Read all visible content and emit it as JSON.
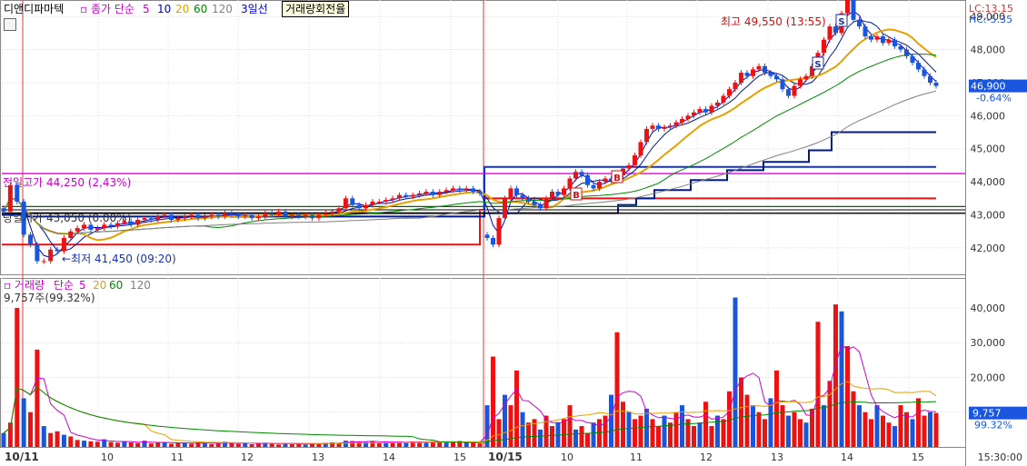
{
  "header": {
    "title": "디앤디파마텍",
    "ma_label": "종가 단순",
    "ma_periods": [
      "5",
      "10",
      "20",
      "60",
      "120"
    ],
    "ma_colors": [
      "#cc00cc",
      "#0000cc",
      "#e6a100",
      "#008800",
      "#808080"
    ],
    "line_label": "3일선",
    "tooltip": "거래량회전율"
  },
  "right_header": {
    "lc": "LC:13.15",
    "hc": "HC:-5.35"
  },
  "annotations": {
    "high_label": "최고 49,550 (13:55)",
    "low_label": "최저 41,450 (09:20)",
    "prev_high_label": "전일고가 44,250 (2,43%)",
    "prev_open_label": "당일시가 43,050 (0.00%)",
    "current_price": "46,900",
    "current_change": "-0.64%",
    "signal_s": "S",
    "signal_b": "B"
  },
  "volume_header": {
    "title": "거래량",
    "ma_label": "단순",
    "ma_periods": [
      "5",
      "20",
      "60",
      "120"
    ],
    "current": "9,757주(99.32%)",
    "current_value": "9,757",
    "current_pct": "99.32%"
  },
  "x_axis": {
    "labels": [
      "10/11",
      "10",
      "11",
      "12",
      "13",
      "14",
      "15",
      "10/15",
      "10",
      "11",
      "12",
      "13",
      "14",
      "15"
    ],
    "time": "15:30:00"
  },
  "chart_data": {
    "type": "candlestick",
    "price_axis": {
      "ticks": [
        42000,
        43000,
        44000,
        45000,
        46000,
        47000,
        48000,
        49000
      ],
      "ylim": [
        41200,
        49500
      ]
    },
    "volume_axis": {
      "ticks": [
        10000,
        20000,
        30000,
        40000
      ],
      "ylim": [
        0,
        46000
      ]
    },
    "reference_lines": {
      "prev_high": 44250,
      "prev_open": 43050,
      "current": 46900
    },
    "day1_price": [
      43100,
      43900,
      43400,
      42400,
      42100,
      41600,
      41600,
      41950,
      41900,
      42300,
      42500,
      42600,
      42700,
      42550,
      42600,
      42700,
      42650,
      42750,
      42800,
      42700,
      42850,
      42900,
      42850,
      42950,
      43000,
      42850,
      42900,
      42950,
      43000,
      42900,
      42950,
      43000,
      42950,
      43050,
      43000,
      42950,
      43000,
      42900,
      42950,
      43050,
      43000,
      43100,
      42950,
      43000,
      42950,
      43000,
      42900,
      43000,
      43050,
      43100,
      43200,
      43500,
      43300,
      43200,
      43300,
      43400,
      43400,
      43450,
      43500,
      43600,
      43550,
      43600,
      43650,
      43700,
      43600,
      43700,
      43750,
      43800,
      43750,
      43800,
      43700,
      43650
    ],
    "day1_volume": [
      4000,
      7000,
      40000,
      14000,
      10000,
      28000,
      6000,
      4000,
      4500,
      3500,
      3000,
      2000,
      1800,
      1600,
      1500,
      2200,
      1400,
      1200,
      1600,
      1300,
      1100,
      1800,
      1000,
      1200,
      1400,
      900,
      1300,
      1100,
      900,
      1300,
      1200,
      800,
      1000,
      1500,
      1100,
      900,
      1200,
      800,
      1000,
      1300,
      900,
      700,
      1100,
      800,
      1000,
      700,
      900,
      1000,
      1200,
      1300,
      1100,
      1800,
      1700,
      1500,
      1400,
      1700,
      1200,
      1400,
      1300,
      1500,
      1200,
      1600,
      1500,
      1200,
      1600,
      1300,
      1200,
      1500,
      1700,
      1300,
      1200,
      1000
    ],
    "day2_price": [
      42300,
      42100,
      42900,
      43500,
      43800,
      43600,
      43500,
      43400,
      43300,
      43200,
      43500,
      43700,
      43600,
      43800,
      44100,
      44300,
      44200,
      43900,
      43800,
      44000,
      44100,
      44050,
      44200,
      44400,
      44500,
      44800,
      45200,
      45600,
      45700,
      45600,
      45650,
      45700,
      45800,
      45900,
      46000,
      46100,
      46200,
      46100,
      46300,
      46400,
      46600,
      46800,
      47000,
      47300,
      47200,
      47400,
      47500,
      47300,
      47200,
      47100,
      46800,
      46600,
      46900,
      47100,
      47200,
      47500,
      47900,
      48300,
      48700,
      48500,
      49100,
      49500,
      48900,
      48700,
      48400,
      48300,
      48400,
      48200,
      48300,
      48100,
      48000,
      47800,
      47600,
      47400,
      47200,
      47000,
      46900
    ],
    "day2_volume": [
      12000,
      26000,
      8000,
      15000,
      12000,
      22000,
      10000,
      7000,
      8000,
      5000,
      9000,
      6000,
      7000,
      8000,
      12000,
      5000,
      6000,
      4000,
      7000,
      8000,
      9000,
      15000,
      33000,
      13000,
      10000,
      8000,
      9000,
      11000,
      8000,
      6000,
      9000,
      7000,
      10000,
      12000,
      8000,
      6000,
      7000,
      13000,
      6000,
      9000,
      8000,
      16000,
      43000,
      20000,
      15000,
      12000,
      10000,
      8000,
      14000,
      22000,
      12000,
      9000,
      10000,
      8000,
      7000,
      11000,
      36000,
      12000,
      19000,
      41000,
      39000,
      29000,
      16000,
      12000,
      10000,
      8000,
      12000,
      9000,
      7000,
      6000,
      12000,
      10000,
      8000,
      14000,
      9000,
      10000,
      9757
    ]
  }
}
